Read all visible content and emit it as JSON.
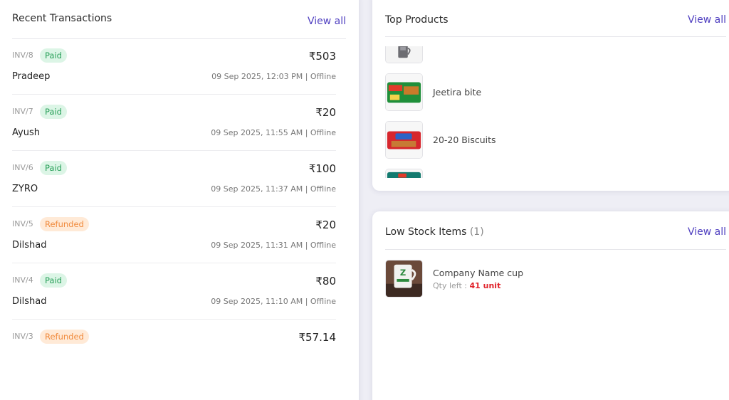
{
  "transactions": {
    "title": "Recent Transactions",
    "view_all": "View all",
    "items": [
      {
        "invoice": "INV/8",
        "status": "Paid",
        "amount": "₹503",
        "customer": "Pradeep",
        "meta": "09 Sep 2025, 12:03 PM | Offline"
      },
      {
        "invoice": "INV/7",
        "status": "Paid",
        "amount": "₹20",
        "customer": "Ayush",
        "meta": "09 Sep 2025, 11:55 AM | Offline"
      },
      {
        "invoice": "INV/6",
        "status": "Paid",
        "amount": "₹100",
        "customer": "ZYRO",
        "meta": "09 Sep 2025, 11:37 AM | Offline"
      },
      {
        "invoice": "INV/5",
        "status": "Refunded",
        "amount": "₹20",
        "customer": "Dilshad",
        "meta": "09 Sep 2025, 11:31 AM | Offline"
      },
      {
        "invoice": "INV/4",
        "status": "Paid",
        "amount": "₹80",
        "customer": "Dilshad",
        "meta": "09 Sep 2025, 11:10 AM | Offline"
      },
      {
        "invoice": "INV/3",
        "status": "Refunded",
        "amount": "₹57.14",
        "customer": "",
        "meta": ""
      }
    ]
  },
  "top_products": {
    "title": "Top Products",
    "view_all": "View all",
    "items": [
      {
        "name": "",
        "thumb": "cup-thumbnail"
      },
      {
        "name": "Jeetira bite",
        "thumb": "green-biscuit-pack"
      },
      {
        "name": "20-20 Biscuits",
        "thumb": "red-biscuit-pack"
      },
      {
        "name": "",
        "thumb": "teal-pack"
      }
    ]
  },
  "low_stock": {
    "title": "Low Stock Items",
    "count": "(1)",
    "view_all": "View all",
    "items": [
      {
        "name": "Company Name cup",
        "qty_label": "Qty left :",
        "qty_value": "41 unit"
      }
    ]
  },
  "colors": {
    "accent": "#4f3fc0",
    "paid_bg": "#dcf5e6",
    "paid_text": "#2aa05a",
    "refunded_bg": "#ffead7",
    "refunded_text": "#f08a3c",
    "low_qty": "#e0222a"
  }
}
